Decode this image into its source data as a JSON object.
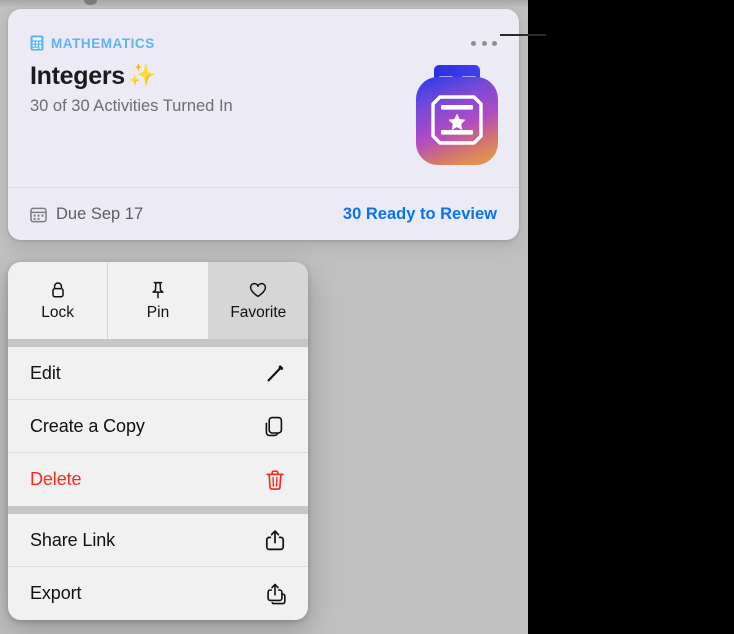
{
  "card": {
    "subject": {
      "icon": "calculator-icon",
      "label": "MATHEMATICS",
      "color": "#5fb4f0"
    },
    "title": "Integers",
    "title_emoji": "✨",
    "status_line": "30 of 30 Activities Turned In",
    "more_button": {
      "icon": "ellipsis-icon",
      "label": "•••"
    },
    "artwork": {
      "icon": "assignment-app-icon",
      "description": "certificate-with-star",
      "gradient_colors": [
        "#2a31e8",
        "#7a47d8",
        "#b04bc4",
        "#d9746a",
        "#e08a5a"
      ]
    },
    "footer": {
      "due_icon": "calendar-icon",
      "due_text": "Due Sep 17",
      "review_link": "30 Ready to Review",
      "review_link_color": "#0a74f0"
    }
  },
  "context_menu": {
    "segments": [
      {
        "icon": "lock-icon",
        "label": "Lock",
        "active": false
      },
      {
        "icon": "pin-icon",
        "label": "Pin",
        "active": false
      },
      {
        "icon": "heart-icon",
        "label": "Favorite",
        "active": true
      }
    ],
    "groups": [
      {
        "rows": [
          {
            "label": "Edit",
            "icon": "pencil-icon",
            "destructive": false
          },
          {
            "label": "Create a Copy",
            "icon": "duplicate-icon",
            "destructive": false
          },
          {
            "label": "Delete",
            "icon": "trash-icon",
            "destructive": true
          }
        ]
      },
      {
        "rows": [
          {
            "label": "Share Link",
            "icon": "share-icon",
            "destructive": false
          },
          {
            "label": "Export",
            "icon": "export-icon",
            "destructive": false
          }
        ]
      }
    ]
  }
}
